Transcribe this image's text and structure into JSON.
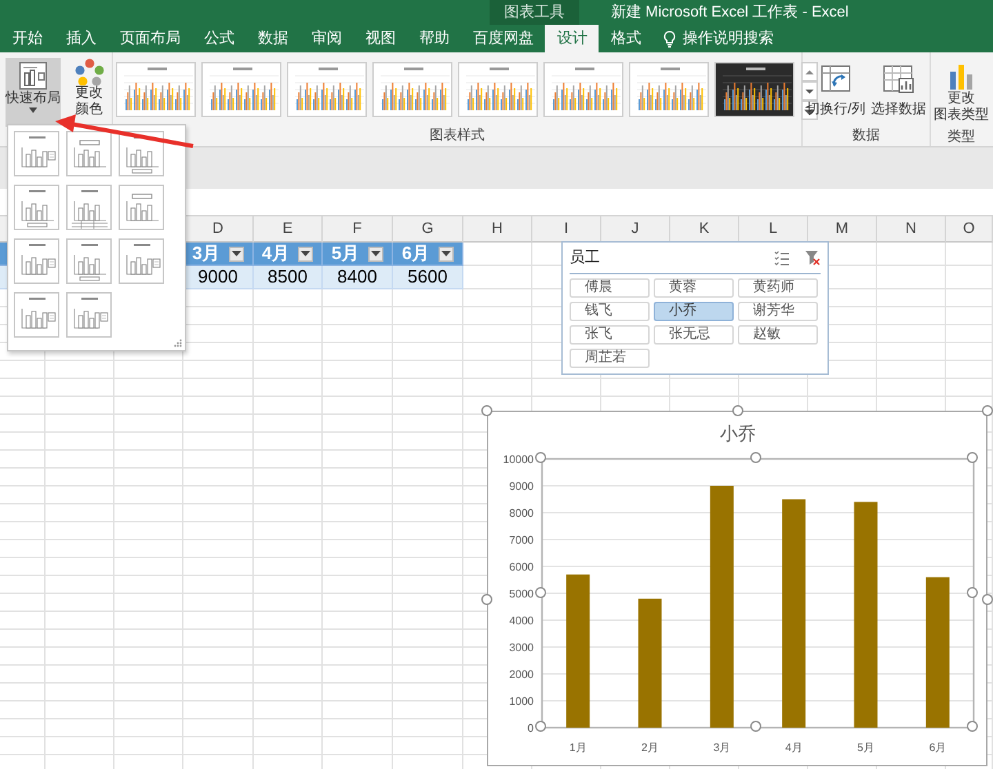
{
  "window": {
    "context_tab": "图表工具",
    "title": "新建 Microsoft Excel 工作表  -  Excel"
  },
  "tabs": [
    {
      "label": "开始",
      "selected": false
    },
    {
      "label": "插入",
      "selected": false
    },
    {
      "label": "页面布局",
      "selected": false
    },
    {
      "label": "公式",
      "selected": false
    },
    {
      "label": "数据",
      "selected": false
    },
    {
      "label": "审阅",
      "selected": false
    },
    {
      "label": "视图",
      "selected": false
    },
    {
      "label": "帮助",
      "selected": false
    },
    {
      "label": "百度网盘",
      "selected": false
    },
    {
      "label": "设计",
      "selected": true
    },
    {
      "label": "格式",
      "selected": false
    }
  ],
  "tell_me": "操作说明搜索",
  "ribbon": {
    "quick_layout": {
      "label": "快速布局",
      "expanded": true
    },
    "change_colors": {
      "lines": [
        "更改",
        "颜色"
      ]
    },
    "chart_styles": {
      "label": "图表样式",
      "styles": [
        {
          "kind": "light"
        },
        {
          "kind": "light"
        },
        {
          "kind": "light"
        },
        {
          "kind": "light"
        },
        {
          "kind": "light"
        },
        {
          "kind": "light"
        },
        {
          "kind": "light"
        },
        {
          "kind": "dark"
        }
      ]
    },
    "data_group": {
      "label": "数据",
      "buttons": [
        {
          "kind": "switch",
          "label": "切换行/列"
        },
        {
          "kind": "select",
          "label": "选择数据"
        }
      ]
    },
    "type_group": {
      "label": "类型",
      "button": {
        "lines": [
          "更改",
          "图表类型"
        ]
      }
    }
  },
  "layout_menu": {
    "options": [
      {
        "kind": "right"
      },
      {
        "kind": "top"
      },
      {
        "kind": "bottom"
      },
      {
        "kind": "bottom"
      },
      {
        "kind": "table"
      },
      {
        "kind": "top"
      },
      {
        "kind": "right"
      },
      {
        "kind": "bottom"
      },
      {
        "kind": "right"
      },
      {
        "kind": "right"
      },
      {
        "kind": "right"
      }
    ]
  },
  "sheet": {
    "columns": [
      "D",
      "E",
      "F",
      "G",
      "H",
      "I",
      "J",
      "K",
      "L",
      "M",
      "N",
      "O"
    ],
    "table": {
      "headers": [
        "3月",
        "4月",
        "5月",
        "6月"
      ],
      "rows": [
        [
          "9000",
          "8500",
          "8400",
          "5600"
        ]
      ]
    }
  },
  "slicer": {
    "title": "员工",
    "items": [
      {
        "label": "傅晨",
        "selected": false
      },
      {
        "label": "黄蓉",
        "selected": false
      },
      {
        "label": "黄药师",
        "selected": false
      },
      {
        "label": "钱飞",
        "selected": false
      },
      {
        "label": "小乔",
        "selected": true
      },
      {
        "label": "谢芳华",
        "selected": false
      },
      {
        "label": "张飞",
        "selected": false
      },
      {
        "label": "张无忌",
        "selected": false
      },
      {
        "label": "赵敏",
        "selected": false
      },
      {
        "label": "周芷若",
        "selected": false
      }
    ]
  },
  "chart": {
    "chart_data": {
      "type": "bar",
      "title": "小乔",
      "categories": [
        "1月",
        "2月",
        "3月",
        "4月",
        "5月",
        "6月"
      ],
      "series": [
        {
          "color": "#997300",
          "values": [
            5700,
            4800,
            9000,
            8500,
            8400,
            5600
          ]
        }
      ],
      "ylim": [
        0,
        10000
      ],
      "grid": true,
      "yticks": [
        0,
        1000,
        2000,
        3000,
        4000,
        5000,
        6000,
        7000,
        8000,
        9000,
        10000
      ]
    }
  }
}
